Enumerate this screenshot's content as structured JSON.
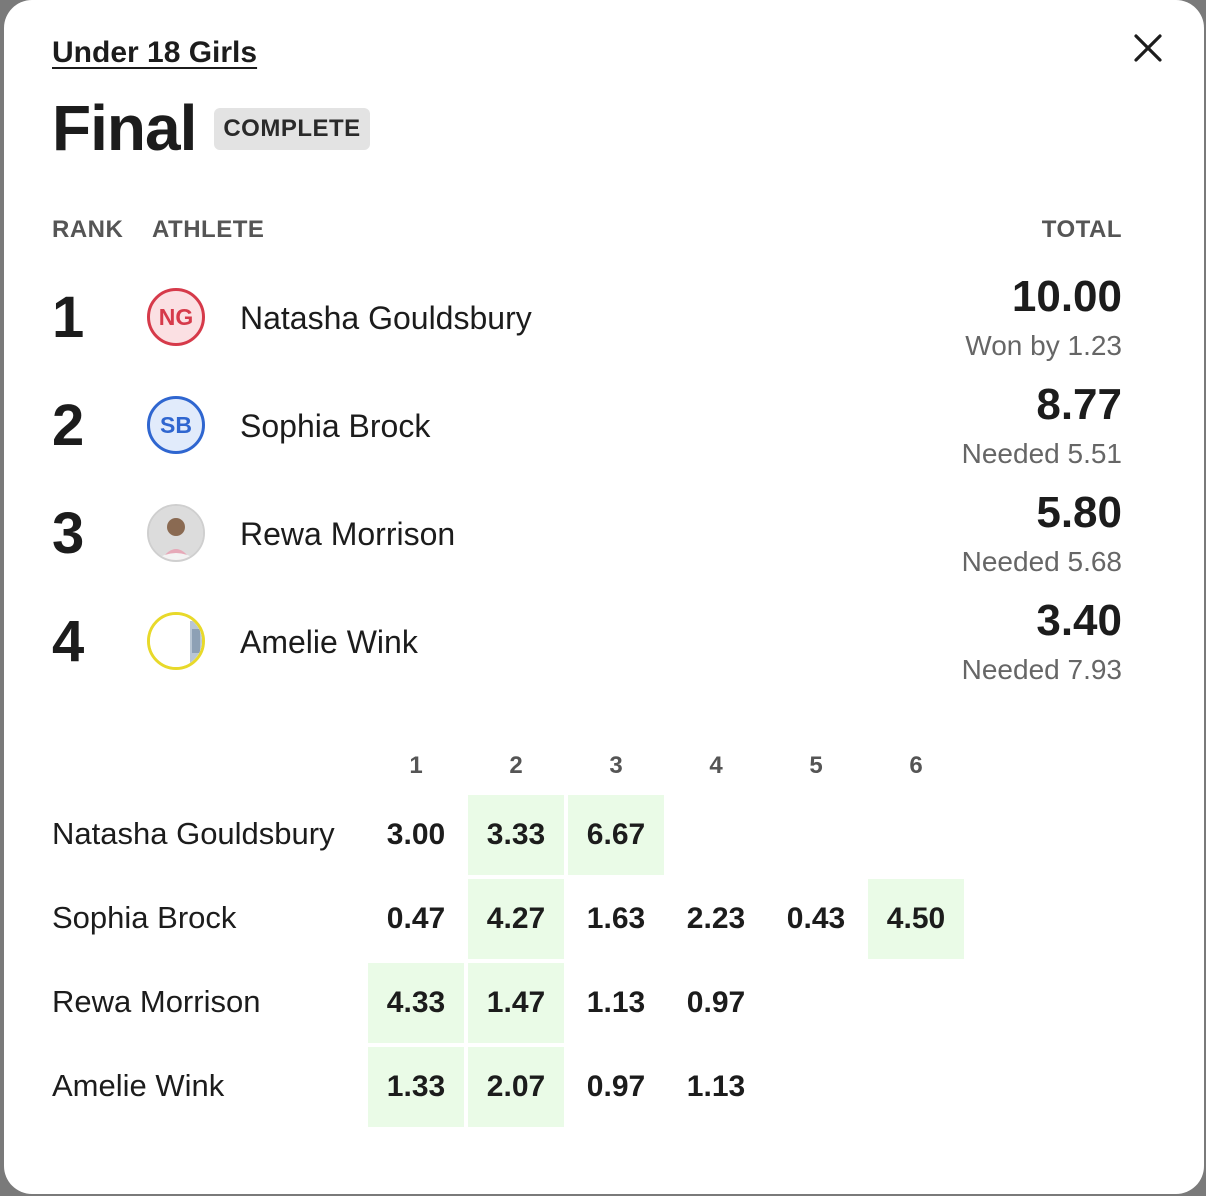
{
  "division": "Under 18 Girls",
  "round": {
    "title": "Final",
    "status": "COMPLETE"
  },
  "columns": {
    "rank": "RANK",
    "athlete": "ATHLETE",
    "total": "TOTAL"
  },
  "close_icon": "close-icon",
  "colors": {
    "best_cell": "#eafbe7",
    "badge_bg": "#e3e3e3",
    "ng": "#d63a4a",
    "sb": "#2f66d0",
    "aw": "#e8d92a"
  },
  "athletes": [
    {
      "rank": "1",
      "initials": "NG",
      "name": "Natasha Gouldsbury",
      "total": "10.00",
      "note": "Won by 1.23",
      "avatar": "initials-red"
    },
    {
      "rank": "2",
      "initials": "SB",
      "name": "Sophia Brock",
      "total": "8.77",
      "note": "Needed 5.51",
      "avatar": "initials-blue"
    },
    {
      "rank": "3",
      "initials": "",
      "name": "Rewa Morrison",
      "total": "5.80",
      "note": "Needed 5.68",
      "avatar": "photo"
    },
    {
      "rank": "4",
      "initials": "",
      "name": "Amelie Wink",
      "total": "3.40",
      "note": "Needed 7.93",
      "avatar": "photo-yellow-ring"
    }
  ],
  "heats": {
    "headers": [
      "1",
      "2",
      "3",
      "4",
      "5",
      "6"
    ],
    "rows": [
      {
        "name": "Natasha Gouldsbury",
        "scores": [
          "3.00",
          "3.33",
          "6.67",
          "",
          "",
          ""
        ],
        "best": [
          false,
          true,
          true,
          false,
          false,
          false
        ]
      },
      {
        "name": "Sophia Brock",
        "scores": [
          "0.47",
          "4.27",
          "1.63",
          "2.23",
          "0.43",
          "4.50"
        ],
        "best": [
          false,
          true,
          false,
          false,
          false,
          true
        ]
      },
      {
        "name": "Rewa Morrison",
        "scores": [
          "4.33",
          "1.47",
          "1.13",
          "0.97",
          "",
          ""
        ],
        "best": [
          true,
          true,
          false,
          false,
          false,
          false
        ]
      },
      {
        "name": "Amelie Wink",
        "scores": [
          "1.33",
          "2.07",
          "0.97",
          "1.13",
          "",
          ""
        ],
        "best": [
          true,
          true,
          false,
          false,
          false,
          false
        ]
      }
    ]
  }
}
